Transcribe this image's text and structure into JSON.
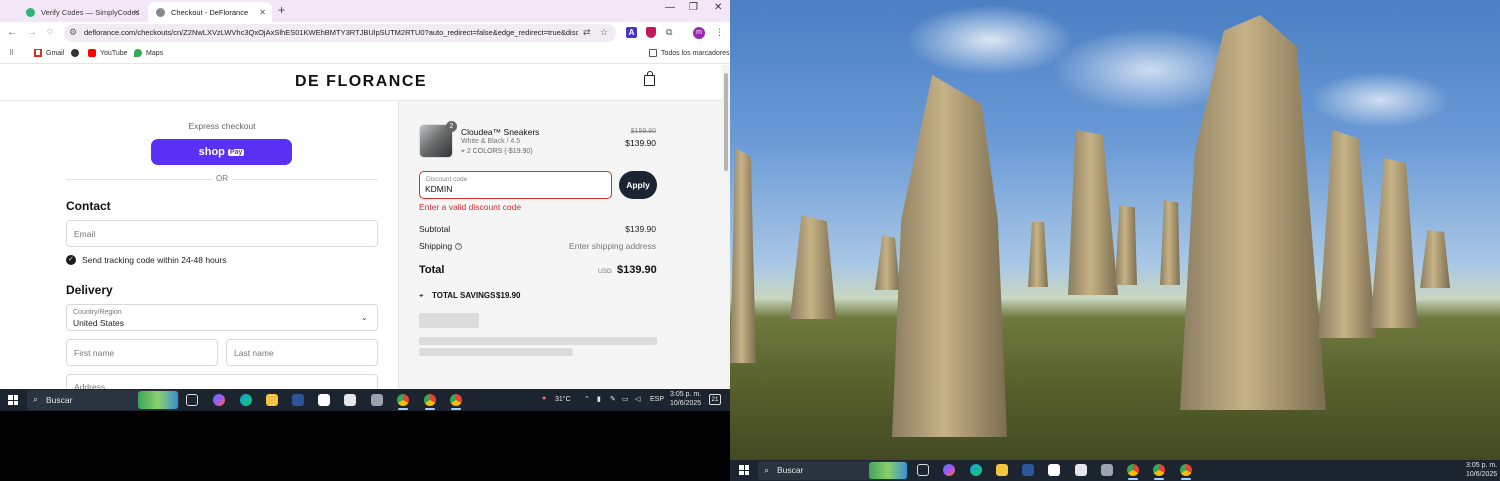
{
  "browser": {
    "tabs": [
      {
        "title": "Verify Codes — SimplyCodes",
        "favicon_color": "#2bb673"
      },
      {
        "title": "Checkout - DeFlorance",
        "favicon_color": "#8a8a8a"
      }
    ],
    "url": "deflorance.com/checkouts/cn/Z2NwLXVzLWVhc3QxOjAxSlhES01KWEhBMTY3RTJBUlpSUTM2RTU0?auto_redirect=false&edge_redirect=true&discount=&edge_redirect=tr...",
    "bookmarks": [
      {
        "label": "Gmail",
        "icon": "gmail-icon"
      },
      {
        "label": "",
        "icon": "globe-icon"
      },
      {
        "label": "YouTube",
        "icon": "youtube-icon"
      },
      {
        "label": "Maps",
        "icon": "maps-icon"
      }
    ],
    "all_bookmarks": "Todos los marcadores",
    "profile_initial": "m"
  },
  "page": {
    "logo": "DE FLORANCE",
    "express_checkout": "Express checkout",
    "shop_pay": "shop",
    "shop_pay_badge": "Pay",
    "or": "OR",
    "contact_title": "Contact",
    "email_placeholder": "Email",
    "tracking_label": "Send tracking code within 24-48 hours",
    "delivery_title": "Delivery",
    "country_label": "Country/Region",
    "country_value": "United States",
    "first_name": "First name",
    "last_name": "Last name",
    "address": "Address"
  },
  "summary": {
    "product_name": "Cloudea™ Sneakers",
    "variant": "White & Black / 4.5",
    "tag": "2 COLORS (-$19.90)",
    "quantity": "2",
    "price_old": "$159.80",
    "price_new": "$139.90",
    "discount_label": "Discount code",
    "discount_value": "KDMIN",
    "apply": "Apply",
    "error": "Enter a valid discount code",
    "subtotal_label": "Subtotal",
    "subtotal_value": "$139.90",
    "shipping_label": "Shipping",
    "shipping_value": "Enter shipping address",
    "total_label": "Total",
    "currency": "USD",
    "total_value": "$139.90",
    "savings_label": "TOTAL SAVINGS",
    "savings_value": "$19.90"
  },
  "taskbar": {
    "search": "Buscar",
    "temperature": "31°C",
    "language": "ESP",
    "time": "3:05 p. m.",
    "date": "10/6/2025",
    "notifications": "21"
  },
  "colors": {
    "shop_pay": "#5a31f4",
    "error": "#d32f2f",
    "apply_button": "#1c2433",
    "taskbar": "#1c2430"
  }
}
